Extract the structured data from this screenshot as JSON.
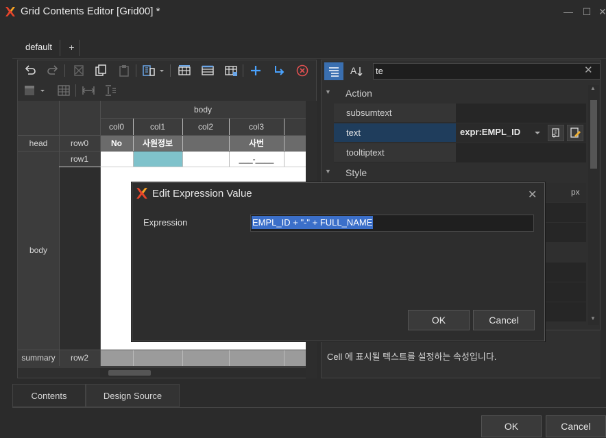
{
  "window": {
    "title": "Grid Contents Editor [Grid00] *",
    "minimize": "—",
    "maximize": "☐",
    "close": "✕"
  },
  "doc_tabs": {
    "active": "default",
    "add": "+"
  },
  "grid": {
    "band_body": "body",
    "columns": [
      "col0",
      "col1",
      "col2",
      "col3"
    ],
    "rows": {
      "head": {
        "band": "head",
        "row": "row0",
        "cells": [
          "No",
          "사원정보",
          "",
          "사번"
        ]
      },
      "body": {
        "band": "body",
        "row": "row1",
        "cells": [
          "",
          "",
          "",
          "___-____"
        ]
      },
      "summary": {
        "band": "summary",
        "row": "row2"
      }
    }
  },
  "properties": {
    "search_value": "te",
    "search_clear": "✕",
    "categories": {
      "action": "Action",
      "style": "Style"
    },
    "items": [
      {
        "name": "subsumtext",
        "value": ""
      },
      {
        "name": "text",
        "value": "expr:EMPL_ID"
      },
      {
        "name": "tooltiptext",
        "value": ""
      }
    ],
    "unit": "px",
    "description": "Cell 에 표시될 텍스트를 설정하는 속성입니다."
  },
  "bottom_tabs": [
    "Contents",
    "Design Source"
  ],
  "footer": {
    "ok": "OK",
    "cancel": "Cancel"
  },
  "modal": {
    "title": "Edit Expression Value",
    "close": "✕",
    "label": "Expression",
    "value": "EMPL_ID + \"-\" + FULL_NAME",
    "ok": "OK",
    "cancel": "Cancel"
  },
  "colors": {
    "selected_row": "#1f3d5c",
    "cell_highlight": "#7fc2cb",
    "head_cell": "#6b6b6b",
    "summary_cell": "#9b9b9b",
    "selection": "#3b6fc9"
  }
}
